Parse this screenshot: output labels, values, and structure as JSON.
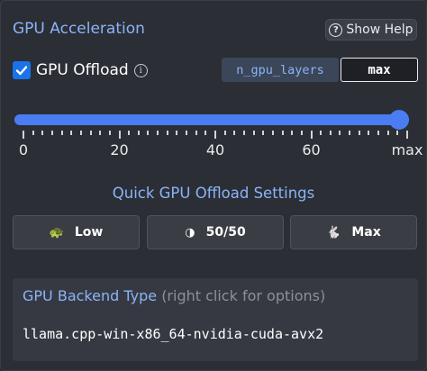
{
  "section": {
    "title": "GPU Acceleration"
  },
  "help_button": {
    "label": "Show Help",
    "icon": "question-circle-icon"
  },
  "offload": {
    "checked": true,
    "label": "GPU Offload",
    "info_icon": "info-icon",
    "param_name": "n_gpu_layers",
    "param_value": "max"
  },
  "slider": {
    "value_fraction": 1.0,
    "ticks": [
      "0",
      "20",
      "40",
      "60",
      "max"
    ],
    "accent": "#4a7df2"
  },
  "quick": {
    "title": "Quick GPU Offload Settings",
    "buttons": [
      {
        "label": "Low",
        "icon": "turtle-icon",
        "glyph": "🐢"
      },
      {
        "label": "50/50",
        "icon": "half-circle-icon",
        "glyph": "◑"
      },
      {
        "label": "Max",
        "icon": "rabbit-icon",
        "glyph": "🐇"
      }
    ]
  },
  "backend": {
    "title": "GPU Backend Type",
    "hint": "(right click for options)",
    "value": "llama.cpp-win-x86_64-nvidia-cuda-avx2"
  }
}
